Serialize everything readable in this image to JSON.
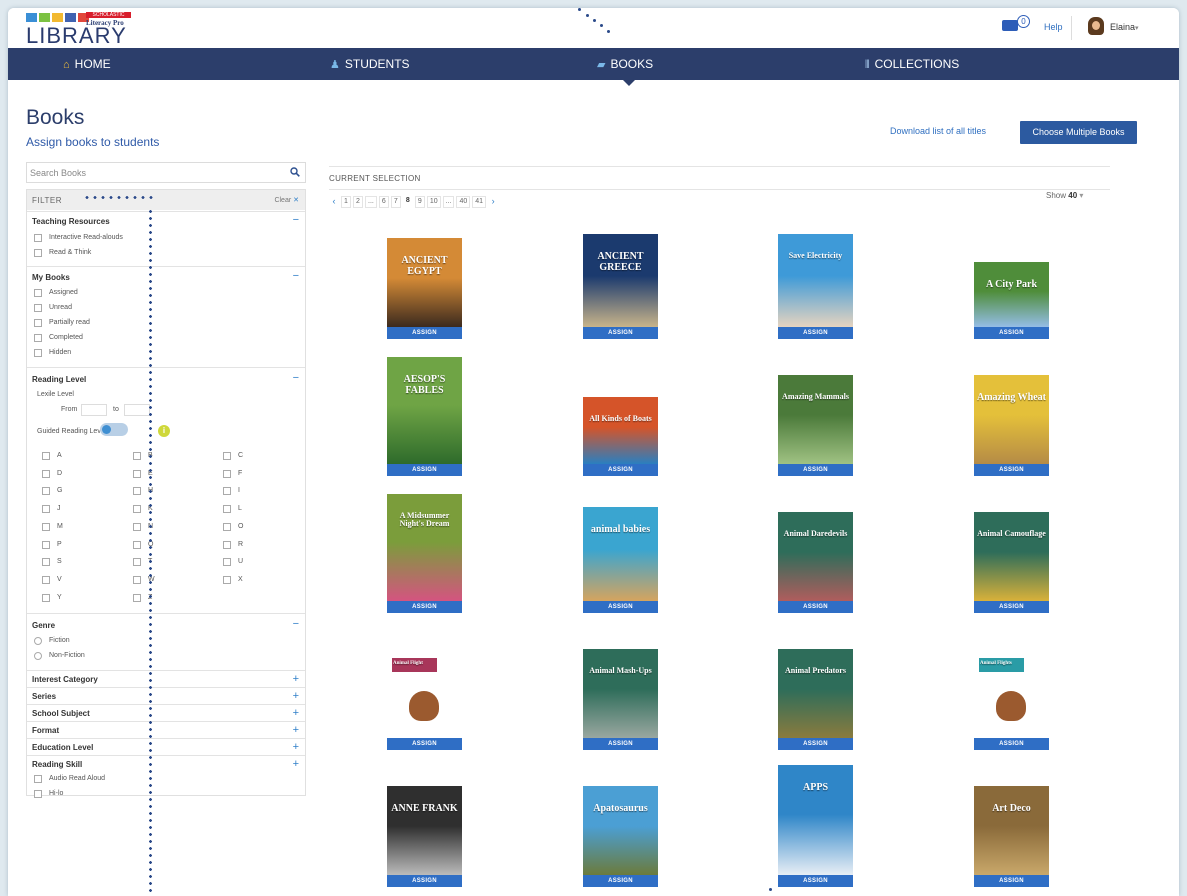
{
  "logo": {
    "tag": "SCHOLASTIC",
    "sub": "Literacy Pro",
    "main": "LIBRARY"
  },
  "header": {
    "mail_count": "0",
    "help": "Help",
    "user": "Elaina"
  },
  "nav": [
    {
      "label": "HOME",
      "icon": "home-icon"
    },
    {
      "label": "STUDENTS",
      "icon": "students-icon"
    },
    {
      "label": "BOOKS",
      "icon": "books-icon"
    },
    {
      "label": "COLLECTIONS",
      "icon": "collections-icon"
    }
  ],
  "page": {
    "title": "Books",
    "subtitle": "Assign books to students",
    "download_link": "Download list of all titles",
    "choose_multiple": "Choose Multiple Books"
  },
  "search": {
    "placeholder": "Search Books"
  },
  "filter": {
    "title": "FILTER",
    "clear": "Clear",
    "teaching_resources": {
      "title": "Teaching Resources",
      "options": [
        "Interactive Read-alouds",
        "Read & Think"
      ]
    },
    "my_books": {
      "title": "My Books",
      "options": [
        "Assigned",
        "Unread",
        "Partially read",
        "Completed",
        "Hidden"
      ]
    },
    "reading_level": {
      "title": "Reading Level",
      "lexile": "Lexile Level",
      "from": "From",
      "to": "to",
      "guided": "Guided Reading Level",
      "levels": [
        "A",
        "B",
        "C",
        "D",
        "E",
        "F",
        "G",
        "H",
        "I",
        "J",
        "K",
        "L",
        "M",
        "N",
        "O",
        "P",
        "Q",
        "R",
        "S",
        "T",
        "U",
        "V",
        "W",
        "X",
        "Y",
        "Z"
      ]
    },
    "genre": {
      "title": "Genre",
      "options": [
        "Fiction",
        "Non-Fiction"
      ]
    },
    "collapsed": [
      "Interest Category",
      "Series",
      "School Subject",
      "Format",
      "Education Level",
      "Reading Skill"
    ],
    "reading_skill_options": [
      "Audio Read Aloud",
      "Hi-lo"
    ]
  },
  "main": {
    "current_selection": "CURRENT SELECTION",
    "pager": [
      "1",
      "2",
      "...",
      "6",
      "7",
      "8",
      "9",
      "10",
      "...",
      "40",
      "41"
    ],
    "current_page": "8",
    "show_label": "Show",
    "show_value": "40",
    "assign_label": "ASSIGN"
  },
  "books": [
    {
      "title": "ANCIENT EGYPT",
      "colors": [
        "#d48a36",
        "#3b2a1e"
      ]
    },
    {
      "title": "ANCIENT GREECE",
      "colors": [
        "#1b3a6e",
        "#c8b48a"
      ]
    },
    {
      "title": "Save Electricity",
      "colors": [
        "#3e9ad8",
        "#e6d4c0"
      ]
    },
    {
      "title": "A City Park",
      "colors": [
        "#4f8d3a",
        "#95bde6"
      ]
    },
    {
      "title": "AESOP'S FABLES",
      "colors": [
        "#6fa445",
        "#2e6b2b"
      ]
    },
    {
      "title": "All Kinds of Boats",
      "colors": [
        "#d55429",
        "#2a7fc0"
      ]
    },
    {
      "title": "Amazing Mammals",
      "colors": [
        "#4b7a3a",
        "#a0c283"
      ]
    },
    {
      "title": "Amazing Wheat",
      "colors": [
        "#e4c03a",
        "#b58b46"
      ]
    },
    {
      "title": "A Midsummer Night's Dream",
      "colors": [
        "#7b9d3b",
        "#d45480"
      ]
    },
    {
      "title": "animal babies",
      "colors": [
        "#3aa5d0",
        "#d6a45e"
      ]
    },
    {
      "title": "Animal Daredevils",
      "colors": [
        "#2e6d5a",
        "#b05d5d"
      ]
    },
    {
      "title": "Animal Camouflage",
      "colors": [
        "#2e6d5a",
        "#d9b13a"
      ]
    },
    {
      "title": "Animal Flight",
      "colors": [
        "#a8365a",
        "#ffffff"
      ]
    },
    {
      "title": "Animal Mash-Ups",
      "colors": [
        "#2e6d5a",
        "#9aa7a0"
      ]
    },
    {
      "title": "Animal Predators",
      "colors": [
        "#2e6d5a",
        "#8a7b3e"
      ]
    },
    {
      "title": "Animal Flights",
      "colors": [
        "#2a9ca6",
        "#ffffff"
      ]
    },
    {
      "title": "ANNE FRANK",
      "colors": [
        "#2f2f2f",
        "#bbbbbb"
      ]
    },
    {
      "title": "Apatosaurus",
      "colors": [
        "#4b9fd4",
        "#6b7b3c"
      ]
    },
    {
      "title": "APPS",
      "colors": [
        "#2f86c8",
        "#e8eef5"
      ]
    },
    {
      "title": "Art Deco",
      "colors": [
        "#8a6a3a",
        "#c9a86a"
      ]
    }
  ]
}
